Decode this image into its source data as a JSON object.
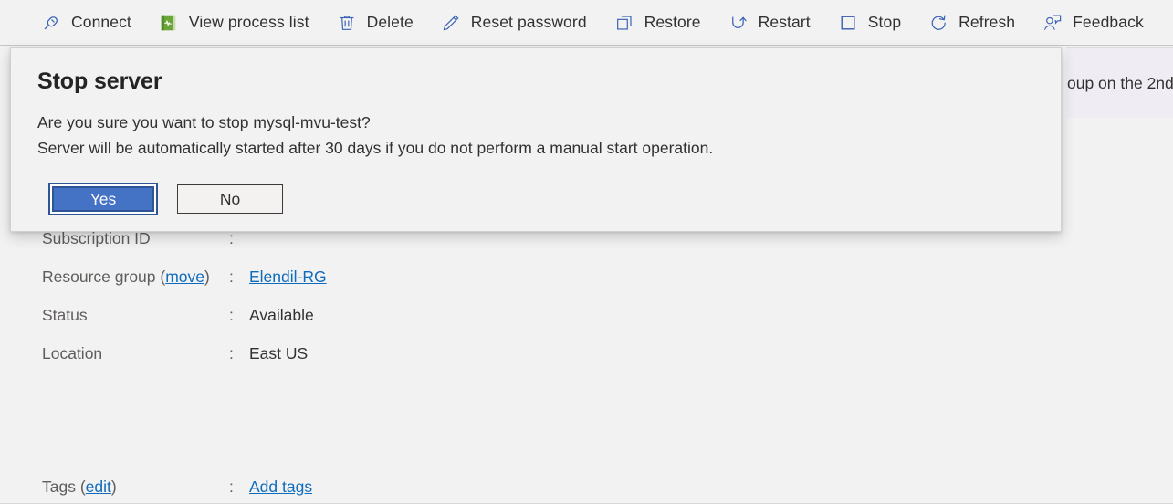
{
  "toolbar": {
    "items": [
      {
        "label": "Connect",
        "icon": "connect-plug-icon"
      },
      {
        "label": "View process list",
        "icon": "process-list-book-icon"
      },
      {
        "label": "Delete",
        "icon": "trash-icon"
      },
      {
        "label": "Reset password",
        "icon": "pencil-icon"
      },
      {
        "label": "Restore",
        "icon": "restore-copy-icon"
      },
      {
        "label": "Restart",
        "icon": "restart-arrow-icon"
      },
      {
        "label": "Stop",
        "icon": "stop-square-icon"
      },
      {
        "label": "Refresh",
        "icon": "refresh-circular-arrow-icon"
      },
      {
        "label": "Feedback",
        "icon": "feedback-person-icon"
      }
    ]
  },
  "banner": {
    "text": "oup on the 2nd"
  },
  "properties": [
    {
      "key": "Subscription ID",
      "key_link": "",
      "colon": ":",
      "value": "",
      "value_is_link": false
    },
    {
      "key": "Resource group (",
      "key_link": "move",
      "key_suffix": ")",
      "colon": ":",
      "value": "Elendil-RG",
      "value_is_link": true
    },
    {
      "key": "Status",
      "key_link": "",
      "colon": ":",
      "value": "Available",
      "value_is_link": false
    },
    {
      "key": "Location",
      "key_link": "",
      "colon": ":",
      "value": "East US",
      "value_is_link": false
    }
  ],
  "tags": {
    "key_prefix": "Tags (",
    "key_link": "edit",
    "key_suffix": ")",
    "colon": ":",
    "value": "Add tags"
  },
  "dialog": {
    "title": "Stop server",
    "line1": "Are you sure you want to stop mysql-mvu-test?",
    "line2": "Server will be automatically started after 30 days if you do not perform a manual start operation.",
    "confirm_label": "Yes",
    "cancel_label": "No"
  },
  "colors": {
    "accent_blue": "#0f6cbd",
    "primary_button": "#4472c4",
    "primary_button_ring": "#2f5597",
    "icon_blue": "#3b63b5",
    "banner_bg": "#f0ecf4",
    "page_bg": "#f2f2f2"
  }
}
